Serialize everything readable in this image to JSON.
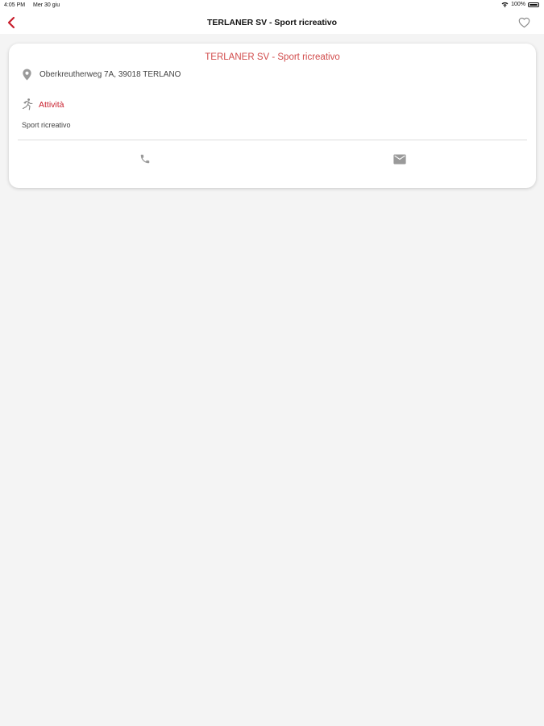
{
  "status_bar": {
    "time": "4:05 PM",
    "date": "Mer 30 giu",
    "battery": "100%"
  },
  "nav": {
    "title": "TERLANER SV - Sport ricreativo",
    "back_icon": "chevron-left-icon",
    "favorite_icon": "heart-outline-icon"
  },
  "card": {
    "title": "TERLANER SV - Sport ricreativo",
    "address": "Oberkreutherweg 7A, 39018  TERLANO",
    "activity_label": "Attività",
    "activity_value": "Sport ricreativo",
    "actions": [
      {
        "icon": "phone-icon"
      },
      {
        "icon": "mail-icon"
      }
    ]
  },
  "colors": {
    "accent": "#c81e2c",
    "title_red": "#d14b4b",
    "background": "#f4f4f4"
  }
}
